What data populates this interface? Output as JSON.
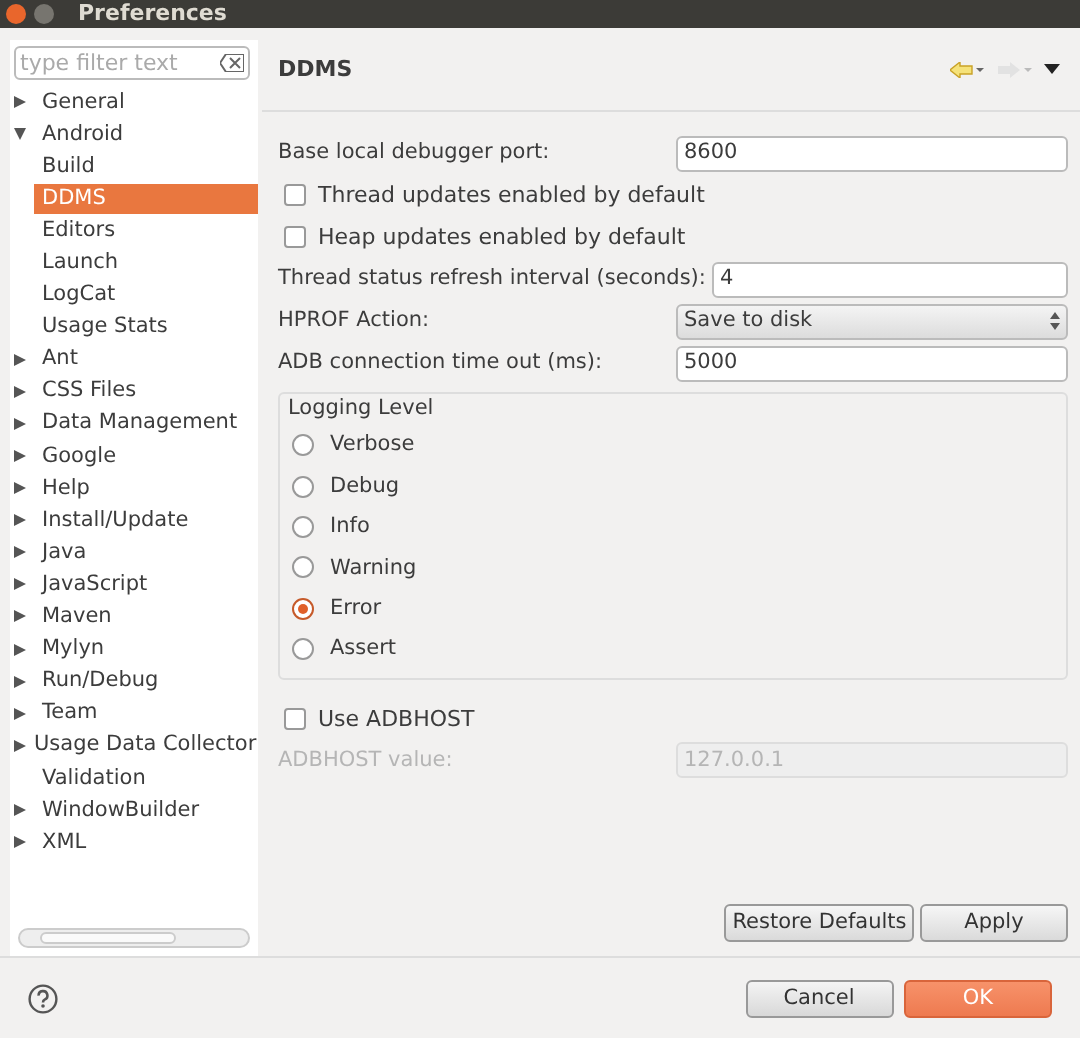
{
  "window": {
    "title": "Preferences"
  },
  "filter": {
    "placeholder": "type filter text"
  },
  "tree": [
    {
      "label": "General",
      "kind": "folder",
      "expanded": false,
      "selected": false
    },
    {
      "label": "Android",
      "kind": "folder",
      "expanded": true,
      "selected": false,
      "children": [
        {
          "label": "Build",
          "selected": false
        },
        {
          "label": "DDMS",
          "selected": true
        },
        {
          "label": "Editors",
          "selected": false
        },
        {
          "label": "Launch",
          "selected": false
        },
        {
          "label": "LogCat",
          "selected": false
        },
        {
          "label": "Usage Stats",
          "selected": false
        }
      ]
    },
    {
      "label": "Ant",
      "kind": "folder",
      "expanded": false,
      "selected": false
    },
    {
      "label": "CSS Files",
      "kind": "folder",
      "expanded": false,
      "selected": false
    },
    {
      "label": "Data Management",
      "kind": "folder",
      "expanded": false,
      "selected": false
    },
    {
      "label": "Google",
      "kind": "folder",
      "expanded": false,
      "selected": false
    },
    {
      "label": "Help",
      "kind": "folder",
      "expanded": false,
      "selected": false
    },
    {
      "label": "Install/Update",
      "kind": "folder",
      "expanded": false,
      "selected": false
    },
    {
      "label": "Java",
      "kind": "folder",
      "expanded": false,
      "selected": false
    },
    {
      "label": "JavaScript",
      "kind": "folder",
      "expanded": false,
      "selected": false
    },
    {
      "label": "Maven",
      "kind": "folder",
      "expanded": false,
      "selected": false
    },
    {
      "label": "Mylyn",
      "kind": "folder",
      "expanded": false,
      "selected": false
    },
    {
      "label": "Run/Debug",
      "kind": "folder",
      "expanded": false,
      "selected": false
    },
    {
      "label": "Team",
      "kind": "folder",
      "expanded": false,
      "selected": false
    },
    {
      "label": "Usage Data Collector",
      "kind": "folder",
      "expanded": false,
      "selected": false
    },
    {
      "label": "Validation",
      "kind": "leaf",
      "selected": false
    },
    {
      "label": "WindowBuilder",
      "kind": "folder",
      "expanded": false,
      "selected": false
    },
    {
      "label": "XML",
      "kind": "folder",
      "expanded": false,
      "selected": false
    }
  ],
  "page": {
    "title": "DDMS",
    "fields": [
      {
        "kind": "text",
        "label": "Base local debugger port:",
        "value": "8600"
      },
      {
        "kind": "checkbox",
        "label": "Thread updates enabled by default",
        "checked": false
      },
      {
        "kind": "checkbox",
        "label": "Heap updates enabled by default",
        "checked": false
      },
      {
        "kind": "text",
        "label": "Thread status refresh interval (seconds):",
        "value": "4"
      },
      {
        "kind": "select",
        "label": "HPROF Action:",
        "value": "Save to disk"
      },
      {
        "kind": "text",
        "label": "ADB connection time out (ms):",
        "value": "5000"
      }
    ],
    "logging_level": {
      "title": "Logging Level",
      "options": [
        {
          "label": "Verbose",
          "selected": false
        },
        {
          "label": "Debug",
          "selected": false
        },
        {
          "label": "Info",
          "selected": false
        },
        {
          "label": "Warning",
          "selected": false
        },
        {
          "label": "Error",
          "selected": true
        },
        {
          "label": "Assert",
          "selected": false
        }
      ]
    },
    "adbhost": {
      "label": "Use ADBHOST",
      "checked": false
    },
    "adbhost_value": {
      "label": "ADBHOST value:",
      "value": "127.0.0.1",
      "disabled": true
    },
    "buttons": [
      "Restore Defaults",
      "Apply"
    ]
  },
  "dialog_buttons": [
    {
      "label": "Cancel",
      "kind": "secondary"
    },
    {
      "label": "OK",
      "kind": "primary"
    }
  ]
}
